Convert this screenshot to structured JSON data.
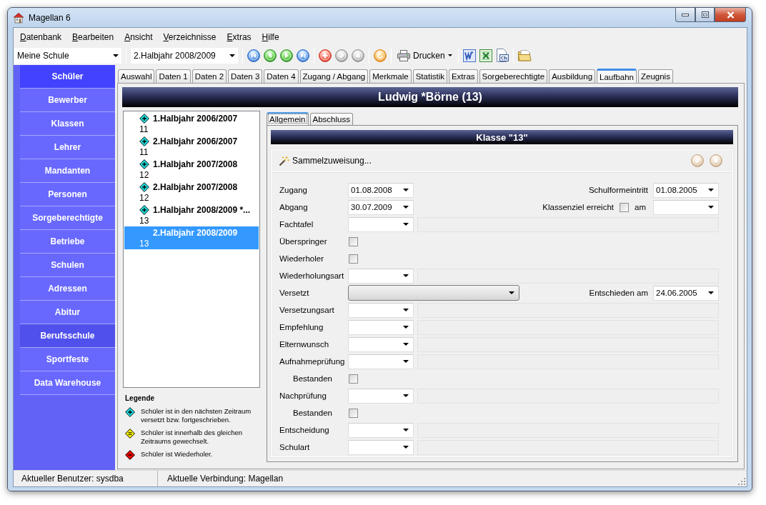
{
  "window": {
    "title": "Magellan 6"
  },
  "menu": [
    {
      "label": "Datenbank"
    },
    {
      "label": "Bearbeiten"
    },
    {
      "label": "Ansicht"
    },
    {
      "label": "Verzeichnisse"
    },
    {
      "label": "Extras"
    },
    {
      "label": "Hilfe"
    }
  ],
  "toolbar": {
    "school": "Meine Schule",
    "period": "2.Halbjahr 2008/2009",
    "action_groups": [
      [
        {
          "kind": "first",
          "disabled": false
        },
        {
          "kind": "previous",
          "disabled": false
        },
        {
          "kind": "next",
          "disabled": false
        },
        {
          "kind": "last",
          "disabled": false
        }
      ],
      [
        {
          "kind": "add",
          "disabled": false
        },
        {
          "kind": "save",
          "disabled": true
        },
        {
          "kind": "cancel",
          "disabled": true
        }
      ],
      [
        {
          "kind": "refresh",
          "disabled": false
        }
      ]
    ],
    "print_label": "Drucken"
  },
  "sidebar": {
    "items": [
      {
        "label": "Schüler",
        "selected": true,
        "hovered": false
      },
      {
        "label": "Bewerber",
        "selected": false,
        "hovered": false
      },
      {
        "label": "Klassen",
        "selected": false,
        "hovered": false
      },
      {
        "label": "Lehrer",
        "selected": false,
        "hovered": false
      },
      {
        "label": "Mandanten",
        "selected": false,
        "hovered": false
      },
      {
        "label": "Personen",
        "selected": false,
        "hovered": false
      },
      {
        "label": "Sorgeberechtigte",
        "selected": false,
        "hovered": false
      },
      {
        "label": "Betriebe",
        "selected": false,
        "hovered": false
      },
      {
        "label": "Schulen",
        "selected": false,
        "hovered": false
      },
      {
        "label": "Adressen",
        "selected": false,
        "hovered": false
      },
      {
        "label": "Abitur",
        "selected": false,
        "hovered": false
      },
      {
        "label": "Berufsschule",
        "selected": false,
        "hovered": true
      },
      {
        "label": "Sportfeste",
        "selected": false,
        "hovered": false
      },
      {
        "label": "Data Warehouse",
        "selected": false,
        "hovered": false
      }
    ]
  },
  "tabs": [
    {
      "label": "Auswahl",
      "selected": false
    },
    {
      "label": "Daten 1",
      "selected": false
    },
    {
      "label": "Daten 2",
      "selected": false
    },
    {
      "label": "Daten 3",
      "selected": false
    },
    {
      "label": "Daten 4",
      "selected": false
    },
    {
      "label": "Zugang / Abgang",
      "selected": false
    },
    {
      "label": "Merkmale",
      "selected": false
    },
    {
      "label": "Statistik",
      "selected": false
    },
    {
      "label": "Extras",
      "selected": false
    },
    {
      "label": "Sorgeberechtigte",
      "selected": false
    },
    {
      "label": "Ausbildung",
      "selected": false
    },
    {
      "label": "Laufbahn",
      "selected": true
    },
    {
      "label": "Zeugnis",
      "selected": false
    }
  ],
  "student_header": "Ludwig *Börne (13)",
  "periods": [
    {
      "kind": "promoted",
      "title": "1.Halbjahr 2006/2007",
      "class": "11",
      "selected": false
    },
    {
      "kind": "promoted",
      "title": "2.Halbjahr 2006/2007",
      "class": "11",
      "selected": false
    },
    {
      "kind": "promoted",
      "title": "1.Halbjahr 2007/2008",
      "class": "12",
      "selected": false
    },
    {
      "kind": "promoted",
      "title": "2.Halbjahr 2007/2008",
      "class": "12",
      "selected": false
    },
    {
      "kind": "promoted",
      "title": "1.Halbjahr 2008/2009 *...",
      "class": "13",
      "selected": false
    },
    {
      "kind": "plain",
      "title": "2.Halbjahr 2008/2009",
      "class": "13",
      "selected": true
    }
  ],
  "legend": {
    "title": "Legende",
    "items": [
      {
        "kind": "promoted",
        "text": "Schüler ist in den nächsten Zeitraum versetzt bzw. fortgeschrieben."
      },
      {
        "kind": "changed",
        "text": "Schüler ist innerhalb des gleichen Zeitraums gewechselt."
      },
      {
        "kind": "repeater",
        "text": "Schüler ist Wiederholer."
      }
    ]
  },
  "detail_tabs": [
    {
      "label": "Allgemein",
      "selected": true
    },
    {
      "label": "Abschluss",
      "selected": false
    }
  ],
  "class_header": "Klasse \"13\"",
  "group_toolbar": {
    "assign_label": "Sammelzuweisung...",
    "actions": [
      {
        "kind": "save",
        "disabled": true
      },
      {
        "kind": "cancel",
        "disabled": true
      }
    ]
  },
  "form": {
    "rows": [
      {
        "kind": "combo",
        "label": "Zugang",
        "value": "01.08.2008",
        "right": {
          "kind": "combo",
          "label": "Schulformeintritt",
          "value": "01.08.2005"
        }
      },
      {
        "kind": "combo",
        "label": "Abgang",
        "value": "30.07.2009",
        "right": {
          "kind": "check_combo",
          "label": "Klassenziel erreicht",
          "checked": false,
          "suffix": "am"
        }
      },
      {
        "kind": "combo_note",
        "label": "Fachtafel"
      },
      {
        "kind": "checkbox",
        "label": "Überspringer",
        "checked": false
      },
      {
        "kind": "checkbox",
        "label": "Wiederholer",
        "checked": false
      },
      {
        "kind": "combo_note",
        "label": "Wiederholungsart"
      },
      {
        "kind": "wide_combo",
        "label": "Versetzt",
        "right": {
          "kind": "combo",
          "label": "Entschieden am",
          "value": "24.06.2005"
        }
      },
      {
        "kind": "combo_note",
        "label": "Versetzungsart"
      },
      {
        "kind": "combo_note",
        "label": "Empfehlung"
      },
      {
        "kind": "combo_note",
        "label": "Elternwunsch"
      },
      {
        "kind": "combo_note",
        "label": "Aufnahmeprüfung"
      },
      {
        "kind": "sub_checkbox",
        "label": "Bestanden",
        "checked": false
      },
      {
        "kind": "combo_note",
        "label": "Nachprüfung"
      },
      {
        "kind": "sub_checkbox",
        "label": "Bestanden",
        "checked": false
      },
      {
        "kind": "combo_note",
        "label": "Entscheidung"
      },
      {
        "kind": "combo_note",
        "label": "Schulart"
      }
    ]
  },
  "status_bar": {
    "user": "Aktueller Benutzer: sysdba",
    "connection": "Aktuelle Verbindung: Magellan"
  }
}
